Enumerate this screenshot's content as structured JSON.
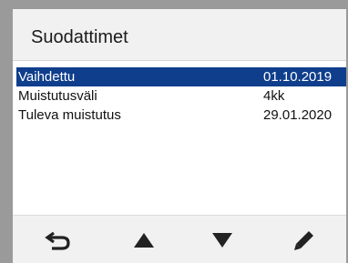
{
  "header": {
    "title": "Suodattimet"
  },
  "rows": [
    {
      "label": "Vaihdettu",
      "value": "01.10.2019",
      "selected": true
    },
    {
      "label": "Muistutusväli",
      "value": "4kk",
      "selected": false
    },
    {
      "label": "Tuleva muistutus",
      "value": "29.01.2020",
      "selected": false
    }
  ],
  "toolbar": {
    "buttons": [
      "back-icon",
      "arrow-up-icon",
      "arrow-down-icon",
      "edit-icon"
    ]
  },
  "colors": {
    "selection": "#0f3e8c",
    "header_bg": "#f1f1f1",
    "icon": "#222222"
  }
}
